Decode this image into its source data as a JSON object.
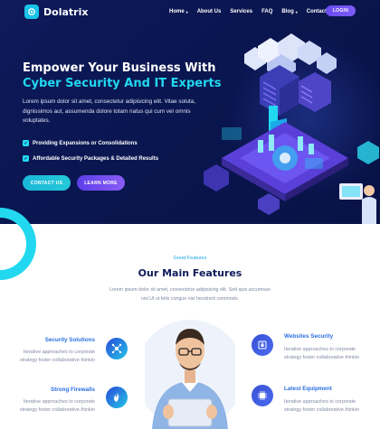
{
  "brand": {
    "name": "Dolatrix"
  },
  "nav": {
    "items": [
      {
        "label": "Home",
        "caret": "▾"
      },
      {
        "label": "About Us",
        "caret": ""
      },
      {
        "label": "Services",
        "caret": ""
      },
      {
        "label": "FAQ",
        "caret": ""
      },
      {
        "label": "Blog",
        "caret": "▾"
      },
      {
        "label": "Contact",
        "caret": ""
      }
    ],
    "login_label": "LOGIN"
  },
  "hero": {
    "title_line1": "Empower Your Business With",
    "title_line2": "Cyber Security And IT Experts",
    "text": "Lorem ipsum dolor sit amet, consectetur adipisicing elit. Vitae soluta, dignissimos aut, assumenda dolore totam natus qui cum vel omnis voluptates.",
    "checks": [
      {
        "mark": "✓",
        "label": "Providing Expansions or Consolidations"
      },
      {
        "mark": "✓",
        "label": "Affordable Security Packages & Detailed Results"
      }
    ],
    "contact_label": "CONTACT US",
    "learn_label": "LEARN MORE"
  },
  "features": {
    "eyebrow": "Great Features",
    "title": "Our Main Features",
    "text": "Lorem ipsum dolor sit amet, consectetur adipisicing elit. Sed quis accumsan nisi Ut ut felis congue nisl hendrerit commodo.",
    "items": [
      {
        "title": "Security Solutions",
        "text": "Iterative approaches to corporate strategy foster collaborative thinkin",
        "icon": "network-icon"
      },
      {
        "title": "Strong Firewalls",
        "text": "Iterative approaches to corporate strategy foster collaborative thinkin",
        "icon": "firewall-icon"
      },
      {
        "title": "Websites Security",
        "text": "Iterative approaches to corporate strategy foster collaborative thinkin",
        "icon": "lock-icon"
      },
      {
        "title": "Latest Equipment",
        "text": "Iterative approaches to corporate strategy foster collaborative thinkin",
        "icon": "chip-icon"
      }
    ]
  },
  "colors": {
    "hero_bg": "#0a1650",
    "accent_cyan": "#22d8f0",
    "accent_purple": "#6a4cf0",
    "heading_navy": "#0e1a5a",
    "feature_title_blue": "#2a6fe0"
  }
}
